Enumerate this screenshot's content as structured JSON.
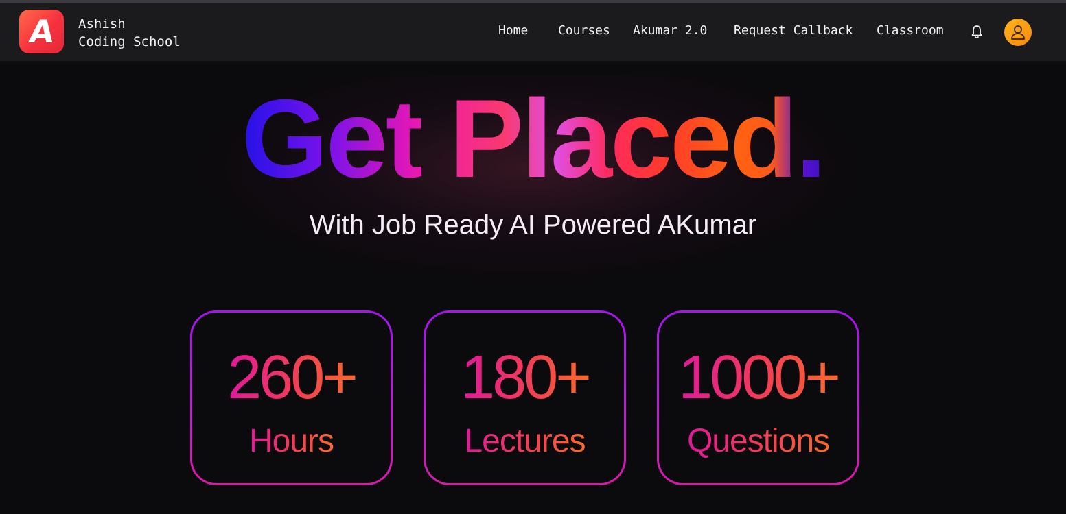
{
  "navbar": {
    "brand_line1": "Ashish",
    "brand_line2": "Coding School",
    "logo_letter": "A",
    "links": [
      {
        "label": "Home"
      },
      {
        "label": "Courses"
      },
      {
        "label": "Akumar 2.0"
      },
      {
        "label": "Request Callback"
      },
      {
        "label": "Classroom"
      }
    ],
    "icons": {
      "notification": "bell-icon",
      "profile": "user-icon"
    }
  },
  "hero": {
    "headline": "Get Placed.",
    "subheadline": "With Job Ready AI Powered AKumar"
  },
  "stats": [
    {
      "value": "260+",
      "label": "Hours"
    },
    {
      "value": "180+",
      "label": "Lectures"
    },
    {
      "value": "1000+",
      "label": "Questions"
    }
  ],
  "colors": {
    "background": "#0b0a0c",
    "navbar": "#1b1b1d",
    "logo_gradient": [
      "#ff6a4a",
      "#e5283a"
    ],
    "avatar": "#f59a12",
    "card_border": "#b817e0",
    "stat_gradient": [
      "#e0189c",
      "#f86a2a"
    ]
  }
}
